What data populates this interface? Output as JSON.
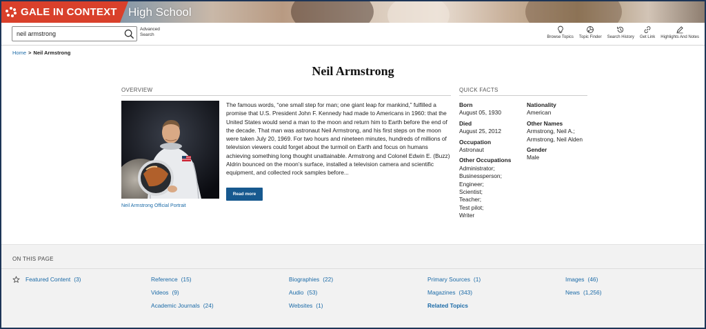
{
  "header": {
    "brand": "GALE IN CONTEXT",
    "edition": "High School",
    "brand_color": "#d9402b"
  },
  "search": {
    "value": "neil armstrong",
    "advanced_line1": "Advanced",
    "advanced_line2": "Search"
  },
  "tools": [
    {
      "label": "Browse Topics",
      "icon": "lightbulb-icon"
    },
    {
      "label": "Topic Finder",
      "icon": "topic-finder-icon"
    },
    {
      "label": "Search History",
      "icon": "history-icon"
    },
    {
      "label": "Get Link",
      "icon": "link-icon"
    },
    {
      "label": "Highlights And Notes",
      "icon": "pencil-icon"
    }
  ],
  "breadcrumb": {
    "home": "Home",
    "separator": ">",
    "current": "Neil Armstrong"
  },
  "page_title": "Neil Armstrong",
  "overview": {
    "heading": "OVERVIEW",
    "image_caption": "Neil Armstrong Official Portrait",
    "text": "The famous words, “one small step for man; one giant leap for mankind,” fulfilled a promise that U.S. President John F. Kennedy had made to Americans in 1960: that the United States would send a man to the moon and return him to Earth before the end of the decade. That man was astronaut Neil Armstrong, and his first steps on the moon were taken July 20, 1969. For two hours and nineteen minutes, hundreds of millions of television viewers could forget about the turmoil on Earth and focus on humans achieving something long thought unattainable. Armstrong and Colonel Edwin E. (Buzz) Aldrin bounced on the moon’s surface, installed a television camera and scientific equipment, and collected rock samples before...",
    "read_more": "Read more"
  },
  "quick_facts": {
    "heading": "QUICK FACTS",
    "col1": [
      {
        "label": "Born",
        "value": [
          "August 05, 1930"
        ]
      },
      {
        "label": "Died",
        "value": [
          "August 25, 2012"
        ]
      },
      {
        "label": "Occupation",
        "value": [
          "Astronaut"
        ]
      },
      {
        "label": "Other Occupations",
        "value": [
          "Administrator;",
          "Businessperson;",
          "Engineer;",
          "Scientist;",
          "Teacher;",
          "Test pilot;",
          "Writer"
        ]
      }
    ],
    "col2": [
      {
        "label": "Nationality",
        "value": [
          "American"
        ]
      },
      {
        "label": "Other Names",
        "value": [
          "Armstrong, Neil A.;",
          "Armstrong, Neil Alden"
        ]
      },
      {
        "label": "Gender",
        "value": [
          "Male"
        ]
      }
    ]
  },
  "on_this_page": {
    "heading": "ON THIS PAGE",
    "links": {
      "featured": {
        "label": "Featured Content",
        "count": "(3)"
      },
      "reference": {
        "label": "Reference",
        "count": "(15)"
      },
      "videos": {
        "label": "Videos",
        "count": "(9)"
      },
      "journals": {
        "label": "Academic Journals",
        "count": "(24)"
      },
      "biographies": {
        "label": "Biographies",
        "count": "(22)"
      },
      "audio": {
        "label": "Audio",
        "count": "(53)"
      },
      "websites": {
        "label": "Websites",
        "count": "(1)"
      },
      "primary": {
        "label": "Primary Sources",
        "count": "(1)"
      },
      "magazines": {
        "label": "Magazines",
        "count": "(343)"
      },
      "related": {
        "label": "Related Topics"
      },
      "images": {
        "label": "Images",
        "count": "(46)"
      },
      "news": {
        "label": "News",
        "count": "(1,256)"
      }
    }
  }
}
